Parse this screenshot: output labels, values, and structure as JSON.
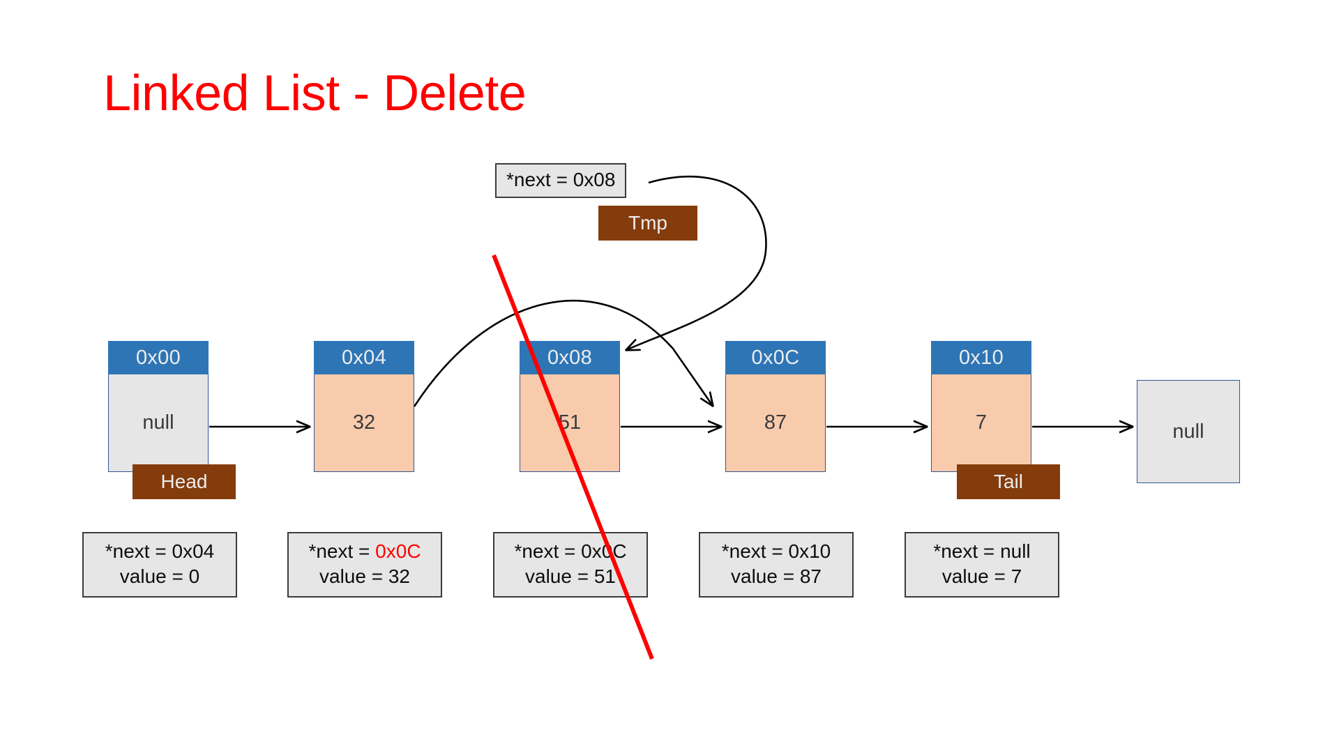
{
  "slide": {
    "title": "Linked List - Delete",
    "title_color": "#FF0000",
    "background": "#FFFFFF"
  },
  "palette": {
    "node_header": "#2E75B6",
    "node_fill": "#F8CBAD",
    "node_empty": "#E6E6E6",
    "node_border": "#2F5496",
    "tag": "#843C0C",
    "info_fill": "#E6E6E6",
    "info_border": "#3B3B3B",
    "strike": "#FF0000",
    "arrow": "#000000"
  },
  "tmp": {
    "pointer_text": "*next = 0x08",
    "tag_label": "Tmp"
  },
  "nodes": [
    {
      "address": "0x00",
      "value": "null",
      "fill": "empty",
      "tag": "Head"
    },
    {
      "address": "0x04",
      "value": "32",
      "fill": "filled",
      "tag": ""
    },
    {
      "address": "0x08",
      "value": "51",
      "fill": "filled",
      "tag": "",
      "deleted": true
    },
    {
      "address": "0x0C",
      "value": "87",
      "fill": "filled",
      "tag": ""
    },
    {
      "address": "0x10",
      "value": "7",
      "fill": "filled",
      "tag": "Tail"
    }
  ],
  "terminal": {
    "value": "null"
  },
  "info_boxes": [
    {
      "next_prefix": "*next = ",
      "next": "0x04",
      "next_highlight": false,
      "value": "value = 0"
    },
    {
      "next_prefix": "*next = ",
      "next": "0x0C",
      "next_highlight": true,
      "value": "value = 32"
    },
    {
      "next_prefix": "*next = ",
      "next": "0x0C",
      "next_highlight": false,
      "value": "value = 51"
    },
    {
      "next_prefix": "*next = ",
      "next": "0x10",
      "next_highlight": false,
      "value": "value = 87"
    },
    {
      "next_prefix": "*next = ",
      "next": "null",
      "next_highlight": false,
      "value": "value = 7"
    }
  ]
}
